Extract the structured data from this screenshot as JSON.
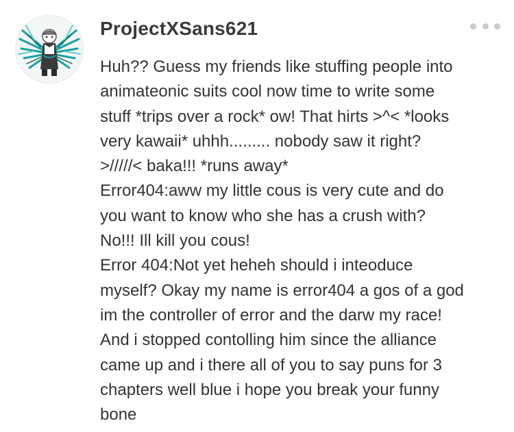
{
  "comment": {
    "author": "ProjectXSans621",
    "more_icon": "more-horizontal-icon",
    "avatar_icon": "profile-avatar-icon",
    "lines": [
      "Huh?? Guess my friends like stuffing people into",
      "animateonic suits cool now time to write some",
      "stuff *trips over a rock* ow! That hirts >^< *looks",
      "very kawaii* uhhh......... nobody saw it right?",
      ">/////< baka!!! *runs away*",
      "Error404:aww my little cous is very cute and do",
      "you want to know who she has a crush with?",
      "No!!! Ill kill you cous!",
      "Error 404:Not yet heheh should i inteoduce",
      "myself? Okay my name is error404 a gos of a god",
      "im the controller of error and the darw my race!",
      "And i stopped contolling him since the alliance",
      "came up and i there all of you to say puns for 3",
      "chapters well blue i hope you break your funny",
      "bone"
    ]
  }
}
